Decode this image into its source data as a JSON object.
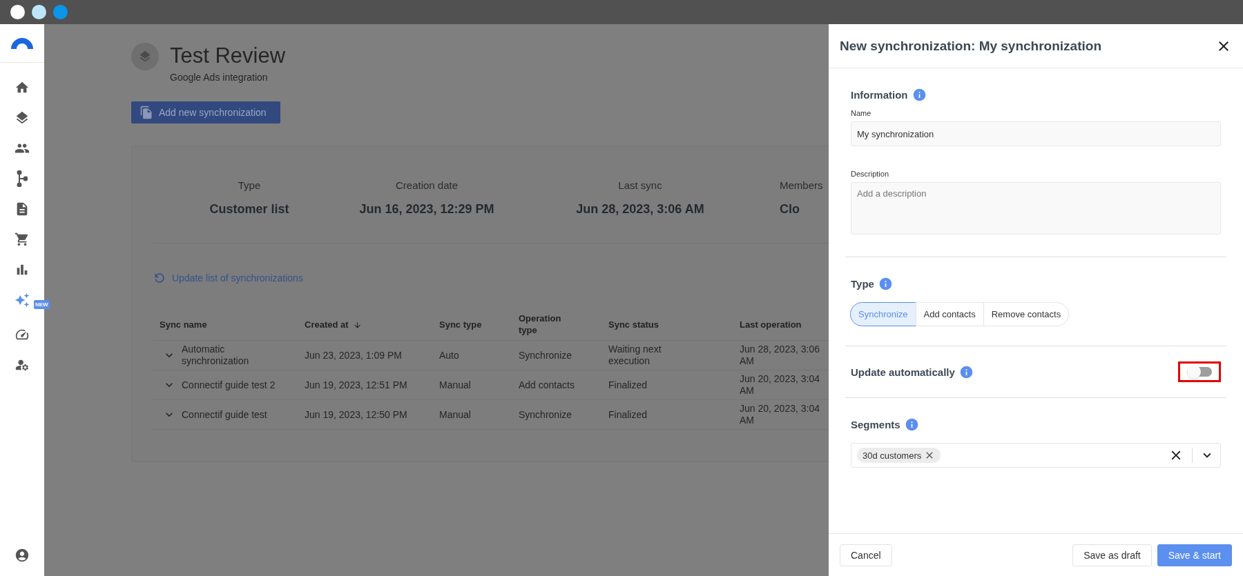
{
  "window": {
    "dots": [
      {
        "color": "#ffffff"
      },
      {
        "color": "#bde6fb"
      },
      {
        "color": "#0a95e8"
      }
    ]
  },
  "sidebar": {
    "new_badge": "NEW"
  },
  "page": {
    "title": "Test Review",
    "subtitle": "Google Ads integration",
    "add_button": "Add new synchronization",
    "stats": [
      {
        "label": "Type",
        "value": "Customer list"
      },
      {
        "label": "Creation date",
        "value": "Jun 16, 2023, 12:29 PM"
      },
      {
        "label": "Last sync",
        "value": "Jun 28, 2023, 3:06 AM"
      },
      {
        "label": "Members",
        "value": "Clo"
      }
    ],
    "refresh_link": "Update list of synchronizations",
    "table": {
      "columns": [
        {
          "label": "Sync name",
          "sorted": false
        },
        {
          "label": "Created at",
          "sorted": true
        },
        {
          "label": "Sync type",
          "sorted": false
        },
        {
          "label": "Operation type",
          "sorted": false
        },
        {
          "label": "Sync status",
          "sorted": false
        },
        {
          "label": "Last operation",
          "sorted": false
        }
      ],
      "rows": [
        [
          "Automatic synchronization",
          "Jun 23, 2023, 1:09 PM",
          "Auto",
          "Synchronize",
          "Waiting next execution",
          "Jun 28, 2023, 3:06 AM"
        ],
        [
          "Connectif guide test 2",
          "Jun 19, 2023, 12:51 PM",
          "Manual",
          "Add contacts",
          "Finalized",
          "Jun 20, 2023, 3:04 AM"
        ],
        [
          "Connectif guide test",
          "Jun 19, 2023, 12:50 PM",
          "Manual",
          "Synchronize",
          "Finalized",
          "Jun 20, 2023, 3:04 AM"
        ]
      ]
    }
  },
  "drawer": {
    "title": "New synchronization: My synchronization",
    "information": {
      "heading": "Information",
      "name_label": "Name",
      "name_value": "My synchronization",
      "description_label": "Description",
      "description_placeholder": "Add a description"
    },
    "type": {
      "heading": "Type",
      "options": [
        {
          "label": "Synchronize",
          "selected": true
        },
        {
          "label": "Add contacts",
          "selected": false
        },
        {
          "label": "Remove contacts",
          "selected": false
        }
      ]
    },
    "update_automatically": {
      "label": "Update automatically",
      "on": false,
      "highlighted": true
    },
    "segments": {
      "heading": "Segments",
      "chips": [
        {
          "label": "30d customers"
        }
      ]
    },
    "buttons": [
      {
        "label": "Cancel",
        "kind": "secondary"
      },
      {
        "label": "Save as draft",
        "kind": "secondary"
      },
      {
        "label": "Save & start",
        "kind": "primary"
      }
    ]
  }
}
